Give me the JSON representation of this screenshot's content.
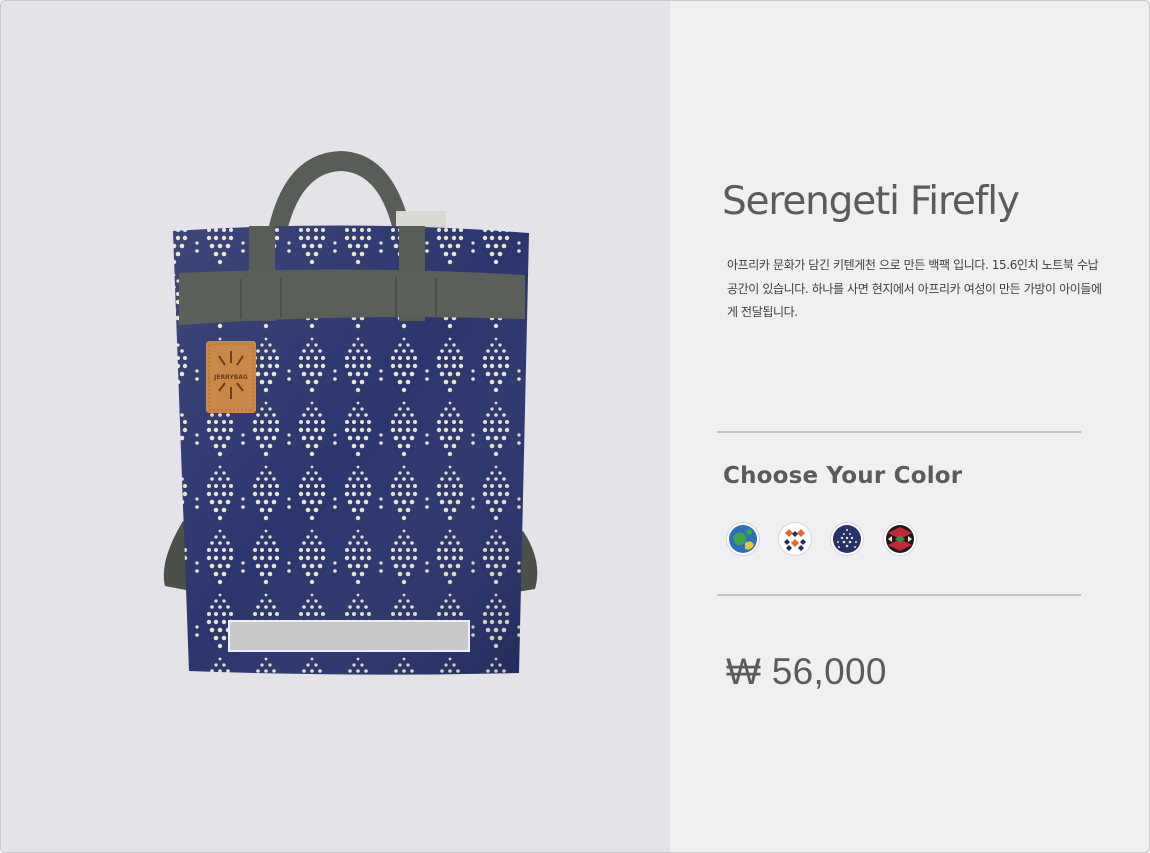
{
  "product": {
    "title": "Serengeti Firefly",
    "description": "아프리카 문화가 담긴 키텐게천 으로 만든 백팩 입니다. 15.6인치 노트북 수납공간이 있습니다. 하나를 사면 현지에서 아프리카 여성이 만든 가방이 아이들에게 전달됩니다.",
    "image_icon": "backpack-product-photo",
    "brand_patch": "JERRYBAG"
  },
  "color_picker": {
    "heading": "Choose Your Color",
    "swatches": [
      {
        "name": "blue-green-wax-print",
        "colors": [
          "#2e6fbf",
          "#3fa34d",
          "#e9c43a"
        ]
      },
      {
        "name": "orange-navy-diamond",
        "colors": [
          "#e5672b",
          "#1f2f5c",
          "#ffffff"
        ]
      },
      {
        "name": "navy-dotted-firefly",
        "colors": [
          "#27326b",
          "#e8e6c8"
        ]
      },
      {
        "name": "red-black-green-geometric",
        "colors": [
          "#c5263a",
          "#1d1a1a",
          "#3c8a44"
        ]
      }
    ],
    "selected": "navy-dotted-firefly"
  },
  "pricing": {
    "price": "₩ 56,000"
  },
  "colors": {
    "image_bg": "#e4e3e8",
    "panel_bg": "#f0f0f3",
    "text": "#5c5a5a",
    "bag_navy": "#27326b",
    "strap": "#5a5f59",
    "patch": "#c98847"
  }
}
